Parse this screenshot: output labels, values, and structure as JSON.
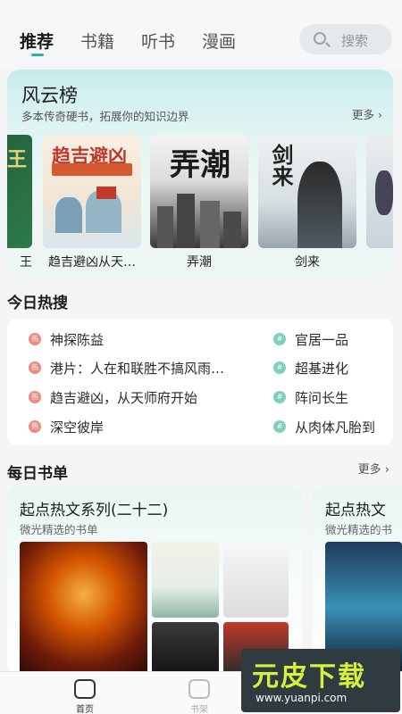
{
  "tabs": [
    {
      "label": "推荐"
    },
    {
      "label": "书籍"
    },
    {
      "label": "听书"
    },
    {
      "label": "漫画"
    }
  ],
  "search": {
    "label": "搜索",
    "icon": "search-icon"
  },
  "ranking": {
    "title": "风云榜",
    "subtitle": "多本传奇硬书，拓展你的知识边界",
    "more": "更多",
    "books": [
      {
        "name": "王",
        "cover_text": "王"
      },
      {
        "name": "趋吉避凶从天…",
        "cover_text": "趋吉避凶"
      },
      {
        "name": "弄潮",
        "cover_text": "弄潮"
      },
      {
        "name": "剑来",
        "cover_text": "剑来"
      },
      {
        "name": "",
        "cover_text": ""
      }
    ]
  },
  "hot": {
    "title": "今日热搜",
    "left": [
      {
        "badge": "热",
        "text": "神探陈益"
      },
      {
        "badge": "热",
        "text": "港片：人在和联胜不搞风雨…"
      },
      {
        "badge": "热",
        "text": "趋吉避凶，从天师府开始"
      },
      {
        "badge": "热",
        "text": "深空彼岸"
      }
    ],
    "right": [
      {
        "badge": "#",
        "text": "官居一品"
      },
      {
        "badge": "#",
        "text": "超基进化"
      },
      {
        "badge": "#",
        "text": "阵问长生"
      },
      {
        "badge": "#",
        "text": "从肉体凡胎到"
      }
    ]
  },
  "daily": {
    "title": "每日书单",
    "more": "更多",
    "lists": [
      {
        "title": "起点热文系列(二十二)",
        "subtitle": "微光精选的书单"
      },
      {
        "title": "起点热文",
        "subtitle": "微光精选的书"
      }
    ]
  },
  "bottom_nav": [
    {
      "label": "首页"
    },
    {
      "label": "书架"
    }
  ],
  "watermark": {
    "main": "元皮下载",
    "url": "www.yuanpi.com"
  },
  "colors": {
    "accent": "#26b5a2",
    "hot_badge": "#ef8a80",
    "tag_badge": "#7fd1bd"
  }
}
